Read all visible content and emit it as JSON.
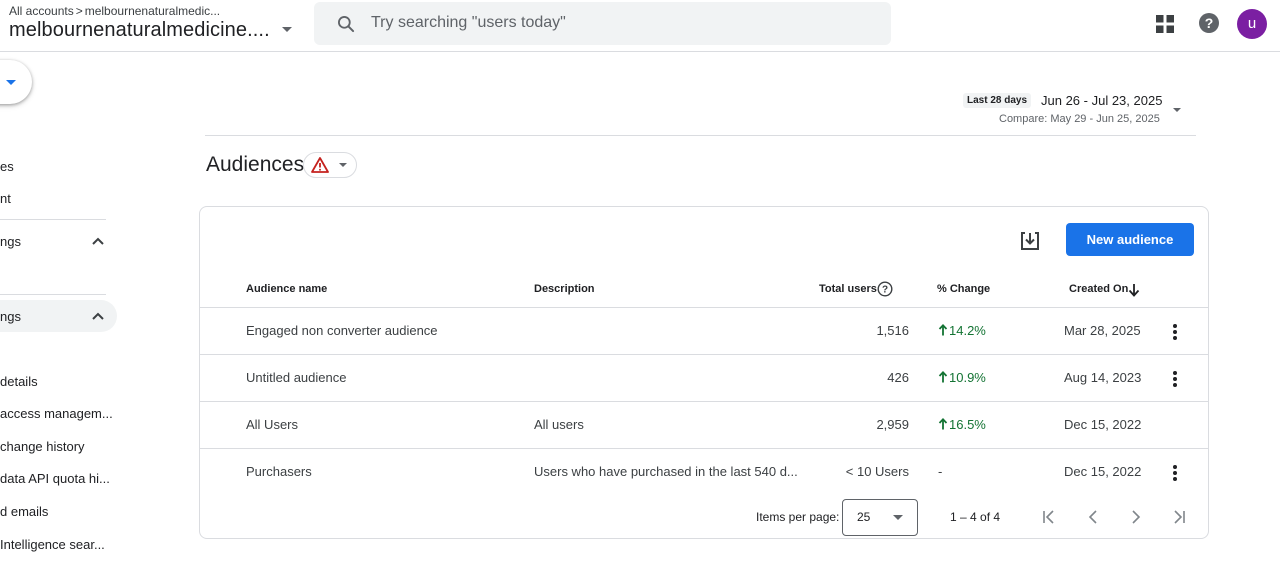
{
  "header": {
    "breadcrumb_root": "All accounts",
    "breadcrumb_sep": ">",
    "breadcrumb_account": "melbournenaturalmedic...",
    "property": "melbournenaturalmedicine....",
    "search_placeholder": "Try searching \"users today\"",
    "avatar_letter": "u",
    "avatar_color": "#7b1fa2"
  },
  "sidebar": {
    "items": [
      {
        "label": "es"
      },
      {
        "label": "nt"
      },
      {
        "label": "ngs"
      },
      {
        "label": "ngs"
      },
      {
        "label": "details"
      },
      {
        "label": "access managem..."
      },
      {
        "label": "change history"
      },
      {
        "label": "data API quota hi..."
      },
      {
        "label": "d emails"
      },
      {
        "label": "Intelligence sear..."
      }
    ]
  },
  "date_range": {
    "preset": "Last 28 days",
    "range": "Jun 26 - Jul 23, 2025",
    "compare": "Compare: May 29 - Jun 25, 2025"
  },
  "page": {
    "title": "Audiences"
  },
  "toolbar": {
    "new_audience_label": "New audience"
  },
  "table": {
    "headers": {
      "name": "Audience name",
      "description": "Description",
      "total_users": "Total users",
      "change": "% Change",
      "created_on": "Created On"
    },
    "rows": [
      {
        "name": "Engaged non converter audience",
        "description": "",
        "users": "1,516",
        "change": "14.2%",
        "created": "Mar 28, 2025"
      },
      {
        "name": "Untitled audience",
        "description": "",
        "users": "426",
        "change": "10.9%",
        "created": "Aug 14, 2023"
      },
      {
        "name": "All Users",
        "description": "All users",
        "users": "2,959",
        "change": "16.5%",
        "created": "Dec 15, 2022"
      },
      {
        "name": "Purchasers",
        "description": "Users who have purchased in the last 540 d...",
        "users": "< 10 Users",
        "change": "-",
        "created": "Dec 15, 2022"
      }
    ]
  },
  "pagination": {
    "items_per_page_label": "Items per page:",
    "items_per_page": "25",
    "range": "1 – 4 of 4"
  },
  "colors": {
    "accent": "#1a73e8",
    "positive": "#137333",
    "warning": "#c5221f"
  }
}
